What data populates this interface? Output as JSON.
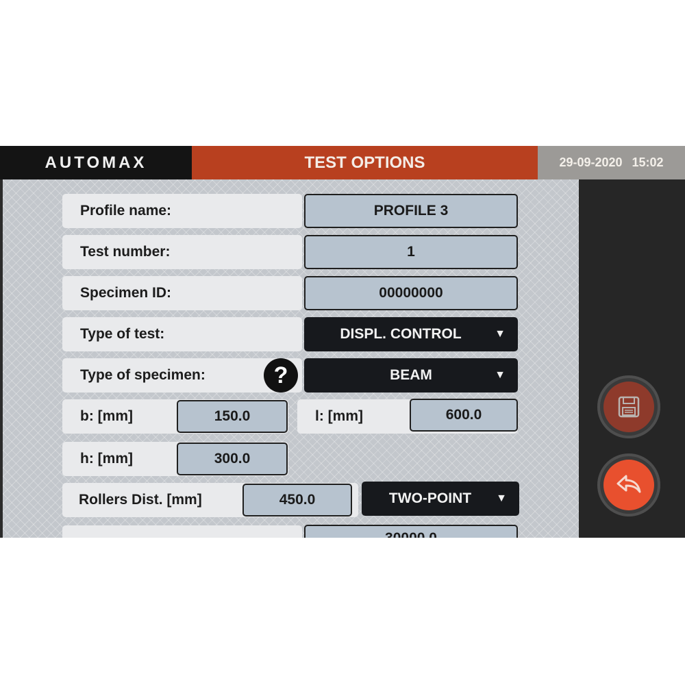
{
  "header": {
    "brand": "AUTOMAX",
    "title": "TEST OPTIONS",
    "date": "29-09-2020",
    "time": "15:02"
  },
  "form": {
    "profile_name": {
      "label": "Profile name:",
      "value": "PROFILE 3"
    },
    "test_number": {
      "label": "Test number:",
      "value": "1"
    },
    "specimen_id": {
      "label": "Specimen ID:",
      "value": "00000000"
    },
    "type_of_test": {
      "label": "Type of test:",
      "value": "DISPL. CONTROL"
    },
    "type_of_specimen": {
      "label": "Type of specimen:",
      "value": "BEAM",
      "help": "?"
    },
    "b": {
      "label": "b: [mm]",
      "value": "150.0"
    },
    "l": {
      "label": "l: [mm]",
      "value": "600.0"
    },
    "h": {
      "label": "h: [mm]",
      "value": "300.0"
    },
    "rollers": {
      "label": "Rollers Dist. [mm]",
      "value": "450.0",
      "mode": "TWO-POINT"
    },
    "partial_row": {
      "value": "30000.0"
    }
  },
  "icons": {
    "save": "save-icon",
    "back": "back-arrow-icon",
    "dropdown": "chevron-down-icon"
  },
  "colors": {
    "header_brand_bg": "#141414",
    "header_title_bg": "#b8401f",
    "header_date_bg": "#9c9a97",
    "save_button": "#8e3a2b",
    "back_button": "#e8502e"
  }
}
